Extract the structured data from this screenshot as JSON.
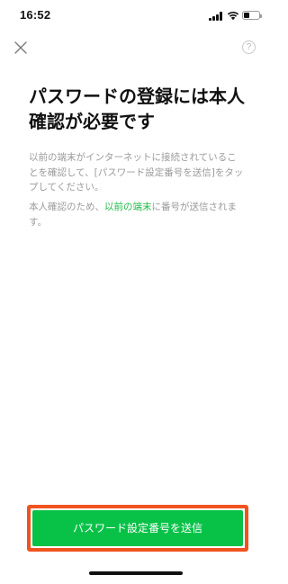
{
  "status_bar": {
    "time": "16:52",
    "signal_icon": "cellular-signal-icon",
    "wifi_icon": "wifi-icon",
    "battery_icon": "battery-icon",
    "battery_level": 0.35
  },
  "header": {
    "close_icon": "close-icon",
    "help_label": "?"
  },
  "main": {
    "title": "パスワードの登録には本人確認が必要です",
    "description": "以前の端末がインターネットに接続されていることを確認して、[パスワード設定番号を送信]をタップしてください。",
    "note_before": "本人確認のため、",
    "note_link": "以前の端末",
    "note_after": "に番号が送信されます。"
  },
  "footer": {
    "send_button_label": "パスワード設定番号を送信"
  },
  "colors": {
    "accent_green": "#07c247",
    "link_green": "#21b94a",
    "highlight_orange": "#f0531f",
    "muted_text": "#9a9a9a"
  }
}
